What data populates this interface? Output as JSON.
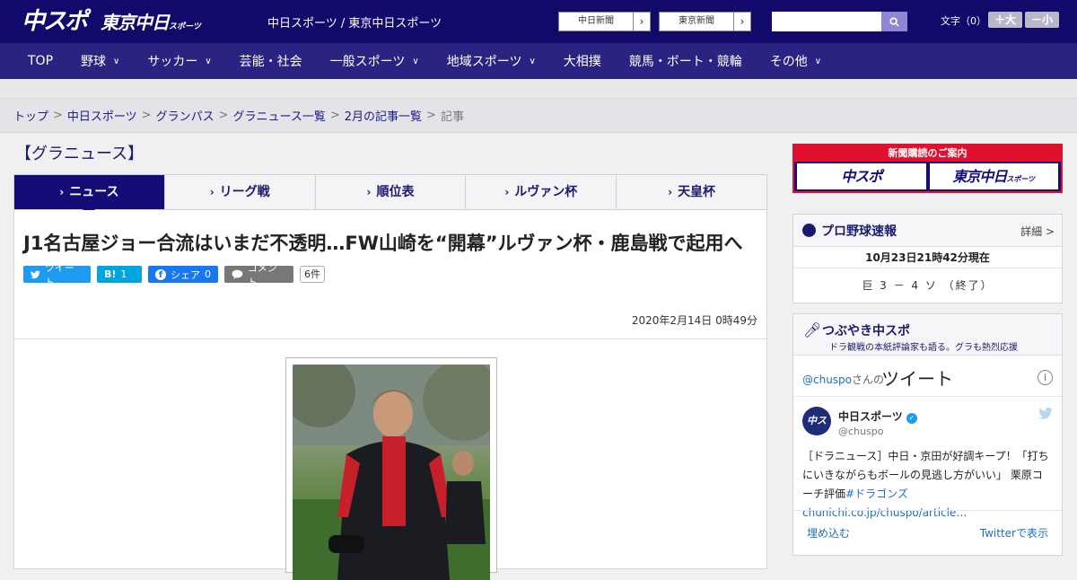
{
  "header": {
    "logo_main": "中スポ",
    "logo_tokyo": "東京中日",
    "logo_tokyo_small": "スポーツ",
    "tagline": "中日スポーツ / 東京中日スポーツ",
    "partner_links": [
      {
        "label": "中日新聞"
      },
      {
        "label": "東京新聞"
      }
    ],
    "search_placeholder": "",
    "font_size_label": "文字（0）",
    "font_bigger": "＋大",
    "font_smaller": "－小"
  },
  "nav": {
    "items": [
      {
        "label": "TOP",
        "dropdown": false
      },
      {
        "label": "野球",
        "dropdown": true
      },
      {
        "label": "サッカー",
        "dropdown": true
      },
      {
        "label": "芸能・社会",
        "dropdown": false
      },
      {
        "label": "一般スポーツ",
        "dropdown": true
      },
      {
        "label": "地域スポーツ",
        "dropdown": true
      },
      {
        "label": "大相撲",
        "dropdown": false
      },
      {
        "label": "競馬・ボート・競輪",
        "dropdown": false
      },
      {
        "label": "その他",
        "dropdown": true
      }
    ]
  },
  "breadcrumb": {
    "items": [
      "トップ",
      "中日スポーツ",
      "グランパス",
      "グラニュース一覧",
      "2月の記事一覧"
    ],
    "current": "記事",
    "separator": ">"
  },
  "main": {
    "section_title": "【グラニュース】",
    "tabs": [
      {
        "label": "ニュース",
        "active": true
      },
      {
        "label": "リーグ戦",
        "active": false
      },
      {
        "label": "順位表",
        "active": false
      },
      {
        "label": "ルヴァン杯",
        "active": false
      },
      {
        "label": "天皇杯",
        "active": false
      }
    ],
    "headline": "J1名古屋ジョー合流はいまだ不透明…FW山崎を“開幕”ルヴァン杯・鹿島戦で起用へ",
    "share": {
      "tweet": "ツイート",
      "hatena_label": "B!",
      "hatena_count": "1",
      "facebook": "シェア",
      "facebook_count": "0",
      "comment": "コメント",
      "comment_count": "6件"
    },
    "date": "2020年2月14日 0時49分"
  },
  "sidebar": {
    "subscribe": {
      "header": "新聞購読のご案内",
      "btn1": "中スポ",
      "btn2": "東京中日",
      "btn2_small": "スポーツ"
    },
    "baseball": {
      "title": "プロ野球速報",
      "detail": "詳細 >",
      "timestamp": "10月23日21時42分現在",
      "score": "巨 3 － 4 ソ （終了）"
    },
    "tweets": {
      "title": "つぶやき中スポ",
      "subtitle": "ドラ観戦の本紙評論家も語る。グラも熱烈応援",
      "account_prefix": "@chuspo",
      "account_suffix": "さんの",
      "heading": "ツイート",
      "avatar_text": "中スポ",
      "tweet_name": "中日スポーツ",
      "tweet_handle": "@chuspo",
      "tweet_text": "［ドラニュース］中日・京田が好調キープ！「打ちにいきながらもボールの見逃し方がいい」 栗原コーチ評価",
      "tweet_tag": "#ドラゴンズ",
      "tweet_link": "chunichi.co.jp/chuspo/article…",
      "embed": "埋め込む",
      "view_on_twitter": "Twitterで表示"
    }
  }
}
